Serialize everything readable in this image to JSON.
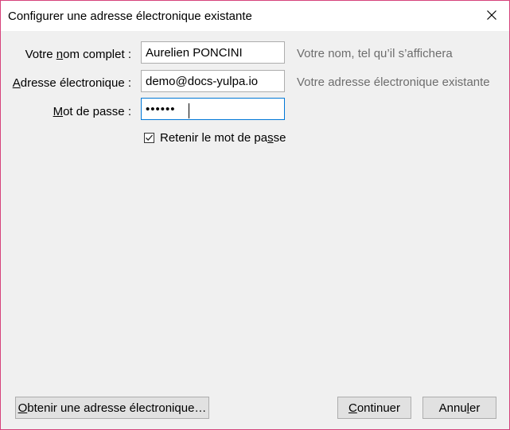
{
  "window": {
    "title": "Configurer une adresse électronique existante"
  },
  "form": {
    "name": {
      "label_pre": "Votre ",
      "label_key": "n",
      "label_post": "om complet :",
      "value": "Aurelien PONCINI",
      "hint": "Votre nom, tel qu’il s’affichera"
    },
    "email": {
      "label_pre": "",
      "label_key": "A",
      "label_post": "dresse électronique :",
      "value": "demo@docs-yulpa.io",
      "hint": "Votre adresse électronique existante"
    },
    "password": {
      "label_pre": "",
      "label_key": "M",
      "label_post": "ot de passe :",
      "value": "••••••"
    },
    "remember": {
      "label_pre": "Retenir le mot de pa",
      "label_key": "s",
      "label_post": "se",
      "checked": true
    }
  },
  "buttons": {
    "get_address": {
      "pre": "",
      "key": "O",
      "post": "btenir une adresse électronique…"
    },
    "continue": {
      "pre": "",
      "key": "C",
      "post": "ontinuer"
    },
    "cancel": {
      "pre": "Annu",
      "key": "l",
      "post": "er"
    }
  },
  "colors": {
    "window_border": "#d6427b",
    "focus_border": "#0078d7",
    "hint_text": "#6d6d6d"
  }
}
